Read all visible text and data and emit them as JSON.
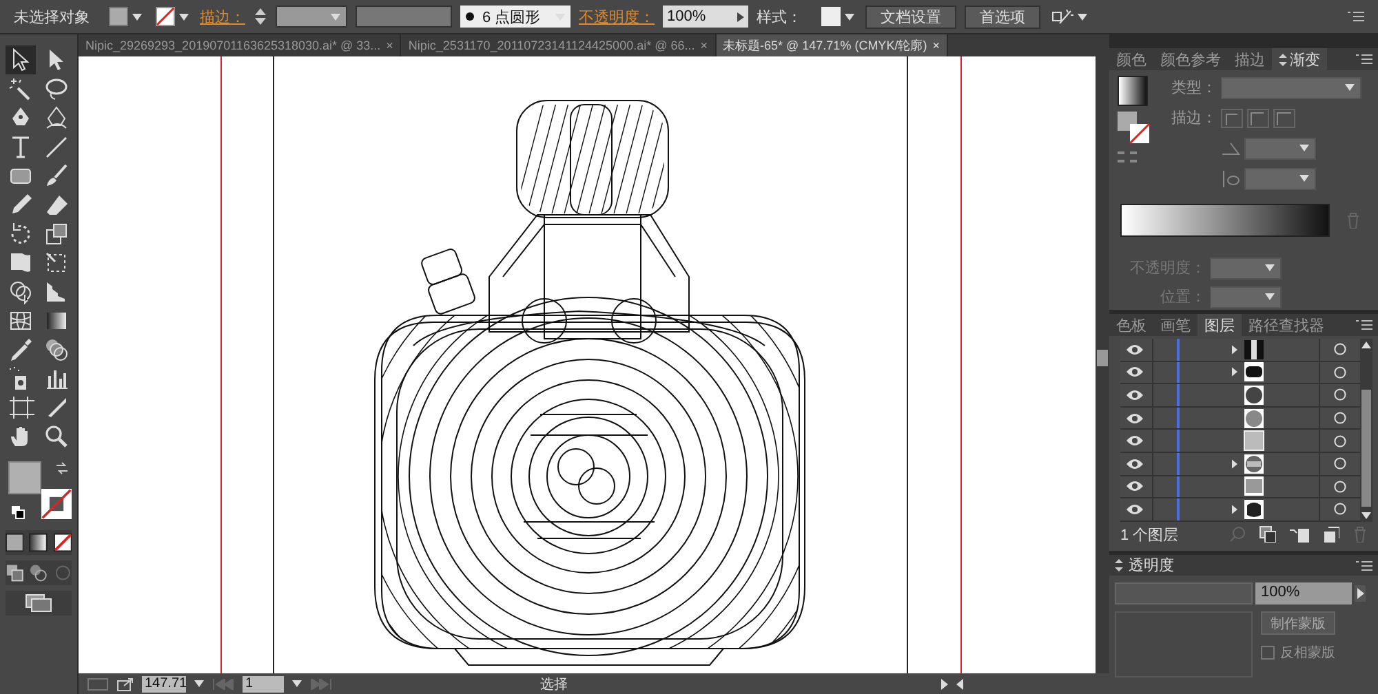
{
  "control_bar": {
    "selection": "未选择对象",
    "stroke_label": "描边：",
    "brush": "6 点圆形",
    "opacity_label": "不透明度：",
    "opacity": "100%",
    "style_label": "样式：",
    "buttons": [
      "文档设置",
      "首选项"
    ]
  },
  "doc_tabs": [
    {
      "label": "Nipic_29269293_20190701163625318030.ai* @ 33...",
      "close": "×",
      "selected": false
    },
    {
      "label": "Nipic_2531170_20110723141124425000.ai* @ 66...",
      "close": "×",
      "selected": false
    },
    {
      "label": "未标题-65* @ 147.71% (CMYK/轮廓)",
      "close": "×",
      "selected": true
    }
  ],
  "tools": [
    {
      "selected": true
    },
    {
      "selected": false
    },
    {
      "selected": false
    },
    {
      "selected": false
    },
    {
      "selected": false
    },
    {
      "selected": false
    },
    {
      "selected": false
    },
    {
      "selected": false
    },
    {
      "selected": false
    },
    {
      "selected": false
    },
    {
      "selected": false
    },
    {
      "selected": false
    },
    {
      "selected": false
    },
    {
      "selected": false
    },
    {
      "selected": false
    },
    {
      "selected": false
    },
    {
      "selected": false
    },
    {
      "selected": false
    },
    {
      "selected": false
    },
    {
      "selected": false
    },
    {
      "selected": false
    },
    {
      "selected": false
    },
    {
      "selected": false
    },
    {
      "selected": false
    },
    {
      "selected": false
    },
    {
      "selected": false
    },
    {
      "selected": false
    },
    {
      "selected": false
    }
  ],
  "gradient_panel": {
    "tabs": [
      {
        "label": "颜色",
        "selected": false
      },
      {
        "label": "颜色参考",
        "selected": false
      },
      {
        "label": "描边",
        "selected": false
      },
      {
        "label": "渐变",
        "selected": true
      }
    ],
    "type_label": "类型：",
    "stroke_label": "描边：",
    "opacity_label": "不透明度：",
    "position_label": "位置："
  },
  "layers_panel": {
    "tabs": [
      {
        "label": "色板",
        "selected": false
      },
      {
        "label": "画笔",
        "selected": false
      },
      {
        "label": "图层",
        "selected": true
      },
      {
        "label": "路径查找器",
        "selected": false
      }
    ],
    "rows": [
      {
        "expandable": true
      },
      {
        "expandable": true
      },
      {
        "expandable": false
      },
      {
        "expandable": false
      },
      {
        "expandable": false
      },
      {
        "expandable": true
      },
      {
        "expandable": false
      },
      {
        "expandable": true
      }
    ],
    "count": "1 个图层"
  },
  "transparency_panel": {
    "title": "透明度",
    "opacity": "100%",
    "make_mask": "制作蒙版",
    "invert_mask": "反相蒙版",
    "invert_mask_checked": false
  },
  "status_bar": {
    "zoom": "147.71",
    "page": "1",
    "tool": "选择"
  }
}
